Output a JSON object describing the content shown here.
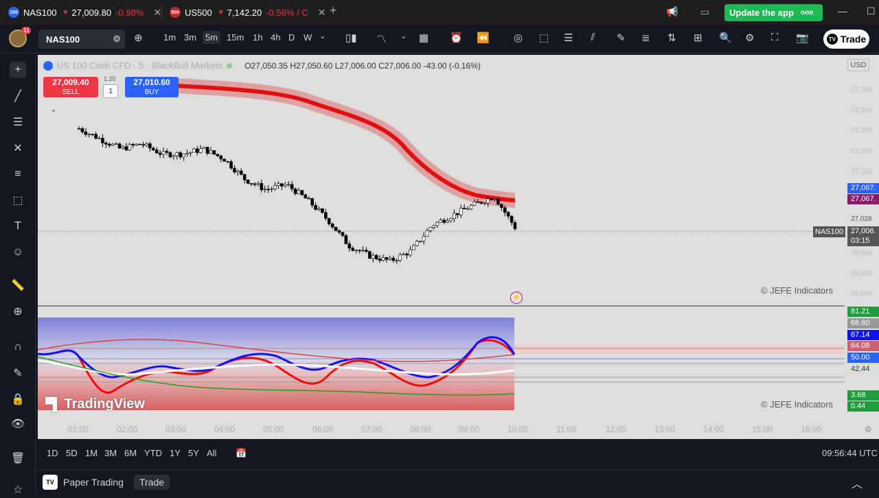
{
  "tabs": [
    {
      "symbol_icon": "100",
      "name": "NAS100",
      "price": "27,009.80",
      "change": "-0.98%"
    },
    {
      "symbol_icon": "500",
      "name": "US500",
      "price": "7,142.20",
      "change": "-0.56% / C"
    }
  ],
  "update_button": {
    "label": "Update the app",
    "dots": "ooo"
  },
  "toolbar": {
    "notification_count": "11",
    "symbol": "NAS100",
    "timeframes": [
      "1m",
      "3m",
      "5m",
      "15m",
      "1h",
      "4h",
      "D",
      "W"
    ],
    "active_timeframe": "5m",
    "trade_label": "Trade",
    "tv_icon": "TV"
  },
  "legend": {
    "name": "US 100 Cash CFD · 5 · BlackBull Markets",
    "ohlc": "O27,050.35  H27,050.60  L27,006.00  C27,006.00  -43.00 (-0.16%)"
  },
  "trade_panel": {
    "sell_price": "27,009.40",
    "sell_label": "SELL",
    "buy_price": "27,010.60",
    "buy_label": "BUY",
    "spread": "1.20",
    "quantity": "1"
  },
  "price_axis": {
    "currency": "USD",
    "ticks": [
      "27,280",
      "27,240",
      "27,200",
      "27,160",
      "27,120",
      "27,100",
      "27,028",
      "26,960",
      "26,920",
      "26,880"
    ],
    "label_blue": "27,067.",
    "label_purple": "27,067.",
    "label_last": "27,006.",
    "countdown": "03:15",
    "symbol_tag": "NAS100"
  },
  "osc_axis": {
    "labels": [
      "81.21",
      "68.80",
      "67.14",
      "64.08",
      "50.00",
      "42.44",
      "3.68",
      "0.44"
    ]
  },
  "watermarks": {
    "main": "© JEFE Indicators",
    "osc": "© JEFE Indicators",
    "brand": "TradingView"
  },
  "time_axis": [
    "01:00",
    "02:00",
    "03:00",
    "04:00",
    "05:00",
    "06:00",
    "07:00",
    "08:00",
    "09:00",
    "10:00",
    "11:00",
    "12:00",
    "13:00",
    "14:00",
    "15:00",
    "16:00"
  ],
  "bottom": {
    "ranges": [
      "1D",
      "5D",
      "1M",
      "3M",
      "6M",
      "YTD",
      "1Y",
      "5Y",
      "All"
    ],
    "clock": "09:56:44 UTC",
    "paper_trading": "Paper Trading",
    "trade": "Trade",
    "tv_icon": "TV"
  },
  "chart_data": {
    "type": "candlestick",
    "approx_close_path": [
      27200,
      27180,
      27160,
      27170,
      27150,
      27150,
      27160,
      27140,
      27100,
      27080,
      27090,
      27060,
      27020,
      26970,
      26950,
      26940,
      26960,
      27010,
      27030,
      27050,
      27067,
      27006
    ],
    "ema_band_path": [
      27240,
      27230,
      27220,
      27200,
      27170,
      27140,
      27100,
      27070,
      27067
    ],
    "last_price": 27006.0,
    "colors": {
      "up": "#ffffff",
      "down": "#000000",
      "band": "#e02020",
      "osc_blue": "#1010ff",
      "osc_red": "#ff0000"
    }
  }
}
